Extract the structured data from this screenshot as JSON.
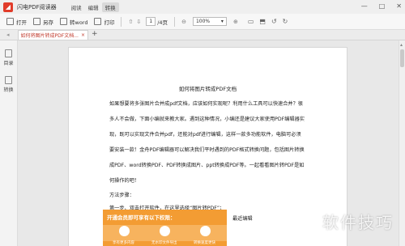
{
  "app": {
    "title": "闪电PDF阅读器",
    "logo_icon": "app-logo-icon",
    "menu": [
      "阅读",
      "编辑",
      "转换"
    ],
    "active_menu_index": 2
  },
  "window_controls": {
    "minimize": "—",
    "maximize": "□",
    "close": "✕"
  },
  "toolbar": {
    "open_label": "打开",
    "saveas_label": "另存",
    "toword_label": "转word",
    "print_label": "打印",
    "current_page": "1",
    "total_pages": "/4页",
    "zoom": "100%"
  },
  "tabs": [
    {
      "label": "如何将图片转成PDF文档...",
      "close": "×"
    }
  ],
  "tab_add": "+",
  "sidebar": [
    {
      "label": "目录",
      "icon": "toc-icon"
    },
    {
      "label": "转换",
      "icon": "convert-icon"
    }
  ],
  "document": {
    "title": "如何将图片转成PDF文档",
    "lines": [
      "如果想要将多张图片合并成pdf文档，应该如何实现呢？利用什么工具可以快速合并？很",
      "多人不会做，下面小编就来教大家。遇到这种情况，小编还是建议大家使用PDF编辑器实",
      "现，既可以实现文件合并pdf，还能对pdf进行编辑，这样一款多功能软件，电脑可必须",
      "要安装一款！金舟PDF编辑器可以解决我们平时遇到的PDF格式转换问题，包括图片转换",
      "成PDF、word转换PDF、PDF转换成图片、ppt转换成PDF等。一起看看图片转PDF是如",
      "何操作的吧！",
      "方法步骤：",
      "第一步、双击打开软件，在这里选择“图片转PDF”；"
    ],
    "banner_title": "开通会员即可享有以下权限：",
    "banner_labels": [
      "享有更多内容",
      "无水印文件导出",
      "转换速度更快"
    ],
    "recent_edit": "最近编辑"
  },
  "watermark": "软件技巧"
}
